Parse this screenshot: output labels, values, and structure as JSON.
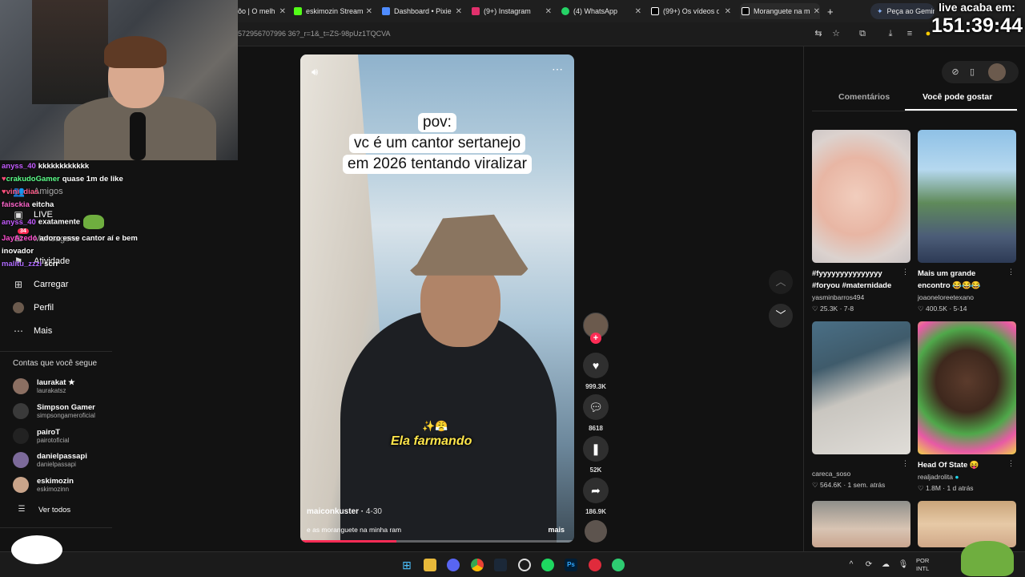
{
  "browser": {
    "tabs": [
      {
        "label": "õo | O melh",
        "color": "#888888"
      },
      {
        "label": "eskimozin Stream",
        "color": "#53fc18"
      },
      {
        "label": "Dashboard • Pixie",
        "color": "#4f8cff"
      },
      {
        "label": "(9+) Instagram",
        "color": "#e1306c"
      },
      {
        "label": "(4) WhatsApp",
        "color": "#25d366"
      },
      {
        "label": "(99+) Os vídeos de",
        "color": "#ffffff"
      },
      {
        "label": "Moranguete na m",
        "color": "#ffffff"
      }
    ],
    "new_tab": "+",
    "gemini_label": "Peça ao Gemini",
    "url": "572956707996 36?_r=1&_t=ZS-98pUz1TQCVA"
  },
  "live_timer": {
    "label": "live acaba em:",
    "time": "151:39:44"
  },
  "chat": [
    {
      "user": "anyss_40",
      "msg": "kkkkkkkkkkkk",
      "color": "#c45cff"
    },
    {
      "user": "crakudoGamer",
      "msg": "quase 1m de like",
      "color": "#5cff8a"
    },
    {
      "user": "vini_dias",
      "msg": "",
      "color": "#ff5c8a"
    },
    {
      "user": "faisckia",
      "msg": "eitcha",
      "color": "#ff66cc"
    },
    {
      "user": "anyss_40",
      "msg": "exatamente",
      "color": "#c45cff"
    },
    {
      "user": "JayAzedo",
      "msg": "adoro esse cantor aí e bem",
      "color": "#ff4fd0"
    },
    {
      "user": "",
      "msg": "inovador",
      "color": "#ffffff"
    },
    {
      "user": "malitu_zzzi",
      "msg": "scrr",
      "color": "#b06bff"
    }
  ],
  "nav": {
    "amigos": "Amigos",
    "live": "LIVE",
    "mensagens": "Mensagens",
    "mensagens_badge": "34",
    "atividade": "Atividade",
    "carregar": "Carregar",
    "perfil": "Perfil",
    "mais": "Mais"
  },
  "following": {
    "title": "Contas que você segue",
    "accounts": [
      {
        "name": "laurakat ★",
        "handle": "laurakatsz"
      },
      {
        "name": "Simpson Gamer",
        "handle": "simpsongameroficial"
      },
      {
        "name": "pairoT",
        "handle": "pairotoficial"
      },
      {
        "name": "danielpassapi",
        "handle": "danielpassapi"
      },
      {
        "name": "eskimozin",
        "handle": "eskimozinn"
      }
    ],
    "see_all": "Ver todos"
  },
  "video": {
    "caption_lines": [
      "pov:",
      "vc é um cantor sertanejo",
      "em 2026 tentando viralizar"
    ],
    "overlay_text": "Ela farmando",
    "author": "maiconkuster",
    "date": "4-30",
    "description": "e as moranguete na minha ram",
    "more": "mais",
    "progress": 0.35
  },
  "actions": {
    "likes": "999.3K",
    "comments": "8618",
    "saves": "52K",
    "shares": "186.9K"
  },
  "right_panel": {
    "tabs": [
      "Comentários",
      "Você pode gostar"
    ],
    "cards": [
      {
        "title_lines": [
          "#fyyyyyyyyyyyyyyy",
          "#foryou #maternidade"
        ],
        "author": "yasminbarros494",
        "likes": "25.3K",
        "time": "7-8"
      },
      {
        "title_lines": [
          "Mais um grande",
          "encontro 😂😂😂"
        ],
        "author": "joaoneloreetexano",
        "likes": "400.5K",
        "time": "5-14"
      },
      {
        "title_lines": [],
        "author": "careca_soso",
        "likes": "564.6K",
        "time": "1 sem. atrás"
      },
      {
        "title_lines": [
          "Head Of State 😝"
        ],
        "author": "realjadrolita",
        "likes": "1.8M",
        "time": "1 d atrás"
      }
    ]
  },
  "taskbar": {
    "lang": "POR",
    "layout": "INTL"
  }
}
